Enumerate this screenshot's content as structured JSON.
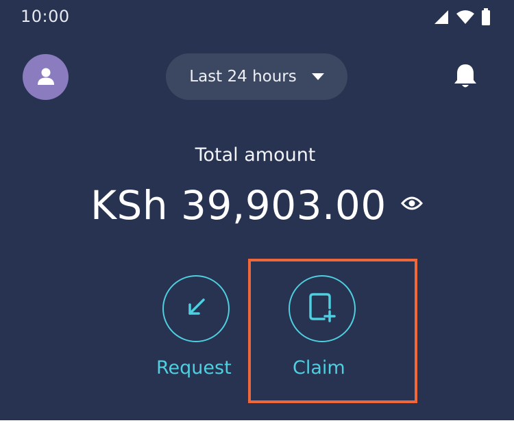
{
  "status_bar": {
    "time": "10:00",
    "icons": [
      "signal-icon",
      "wifi-icon",
      "battery-icon"
    ]
  },
  "header": {
    "avatar_icon": "user-icon",
    "period_selector": {
      "label": "Last 24 hours",
      "icon": "chevron-down-icon"
    },
    "notification_icon": "bell-icon"
  },
  "balance": {
    "label": "Total amount",
    "amount": "KSh 39,903.00",
    "visibility_icon": "eye-icon"
  },
  "actions": [
    {
      "label": "Request",
      "icon": "arrow-down-left-icon"
    },
    {
      "label": "Claim",
      "icon": "claim-add-icon"
    }
  ],
  "colors": {
    "background": "#273350",
    "accent": "#4fcfe0",
    "avatar": "#8b7bbf",
    "pill": "#3c4862",
    "highlight": "#f0683a"
  }
}
